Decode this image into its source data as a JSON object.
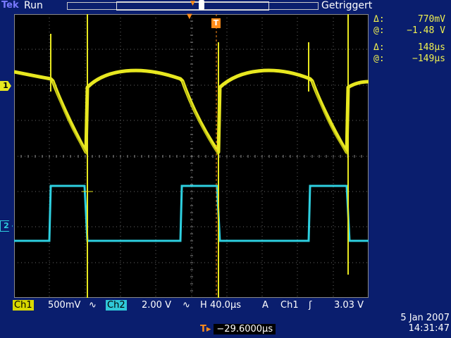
{
  "header": {
    "brand": "Tek",
    "run_state": "Run",
    "trigger_status": "Getriggert"
  },
  "markers": {
    "ch1": "1",
    "ch2": "2",
    "trigger": "T"
  },
  "cursors": {
    "amp_delta": "770mV",
    "amp_at": "−1.48 V",
    "time_delta": "148µs",
    "time_at": "−149µs",
    "delta_symbol": "Δ:",
    "at_symbol": "@:"
  },
  "status": {
    "ch1_label": "Ch1",
    "ch1_scale": "500mV",
    "ch2_label": "Ch2",
    "ch2_scale": "2.00 V",
    "coupling_symbol": "∿",
    "horiz_label": "H",
    "horiz_scale": "40.0µs",
    "acq_label": "A",
    "trig_source": "Ch1",
    "trig_slope_symbol": "ʃ",
    "trig_level": "3.03 V"
  },
  "footer": {
    "date": "5 Jan  2007",
    "time": "14:31:47",
    "offset_icon": "T▸",
    "offset_value": "−29.6000µs"
  },
  "colors": {
    "ch1": "#e8e820",
    "ch2": "#2ed0e0",
    "background": "#0a1e6e",
    "trigger": "#ff8c1a"
  },
  "icons": [
    "trigger-marker-icon",
    "ch1-marker-icon",
    "ch2-marker-icon",
    "coupling-ac-icon",
    "rising-slope-icon",
    "record-position-icon"
  ]
}
